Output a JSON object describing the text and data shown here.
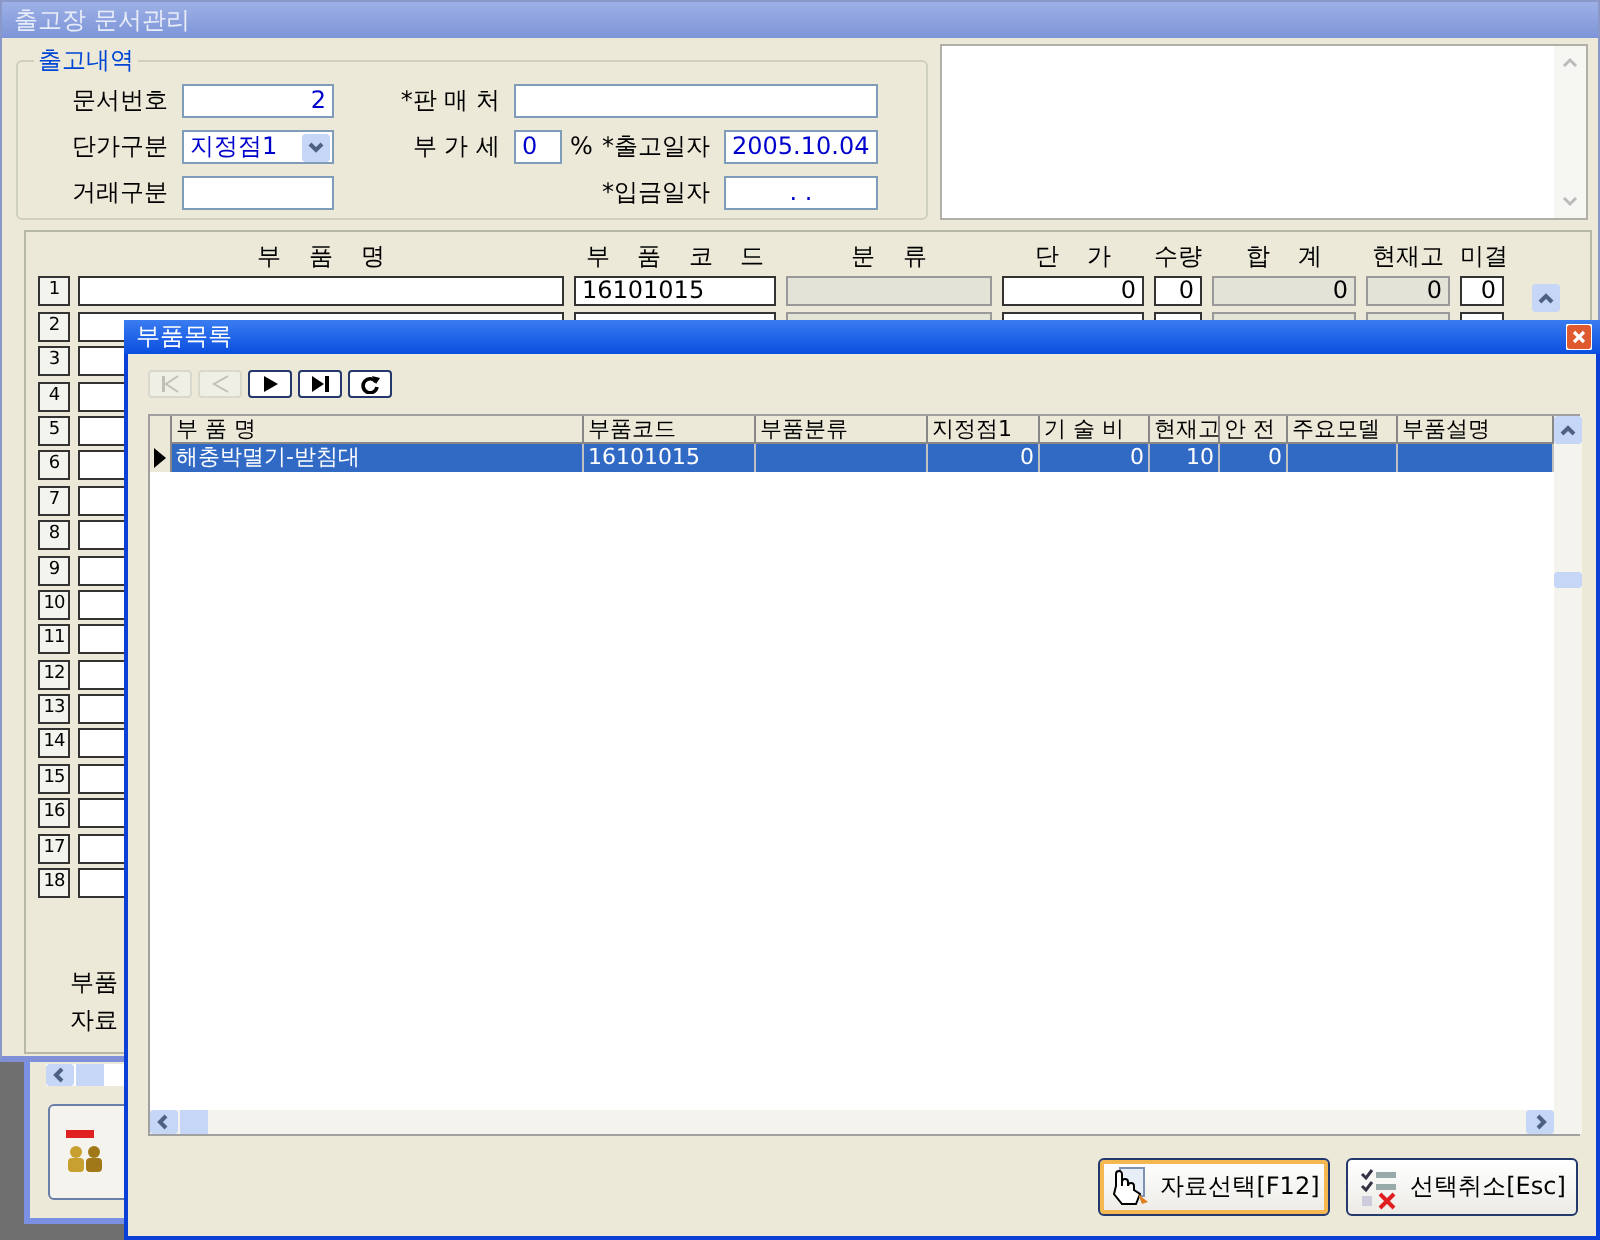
{
  "main_window": {
    "title": "출고장 문서관리",
    "details": {
      "title": "출고내역",
      "doc_no": {
        "label": "문서번호",
        "value": "2"
      },
      "seller": {
        "label": "*판 매 처"
      },
      "price_type": {
        "label": "단가구분",
        "value": "지정점1"
      },
      "vat": {
        "label": "부 가 세",
        "value": "0",
        "unit": "%"
      },
      "ship_date": {
        "label": "*출고일자",
        "value": "2005.10.04"
      },
      "trade_type": {
        "label": "거래구분"
      },
      "pay_date": {
        "label": "*입금일자",
        "value": ".   ."
      }
    },
    "items_grid": {
      "columns": [
        "부 품 명",
        "부 품 코 드",
        "분 류",
        "단 가",
        "수량",
        "합 계",
        "현재고",
        "미결"
      ],
      "rows": [
        {
          "number": "1",
          "code": "16101015",
          "price": "0",
          "qty": "0",
          "total": "0",
          "stock": "0",
          "pending": "0"
        },
        {
          "number": "2"
        },
        {
          "number": "3"
        },
        {
          "number": "4"
        },
        {
          "number": "5"
        },
        {
          "number": "6"
        },
        {
          "number": "7"
        },
        {
          "number": "8"
        },
        {
          "number": "9"
        },
        {
          "number": "10"
        },
        {
          "number": "11"
        },
        {
          "number": "12"
        },
        {
          "number": "13"
        },
        {
          "number": "14"
        },
        {
          "number": "15"
        },
        {
          "number": "16"
        },
        {
          "number": "17"
        },
        {
          "number": "18"
        }
      ]
    },
    "footer_labels": [
      "부품",
      "자료"
    ]
  },
  "part_dialog": {
    "title": "부품목록",
    "toolbar": [
      {
        "kind": "first",
        "disabled": true
      },
      {
        "kind": "prev",
        "disabled": true
      },
      {
        "kind": "next",
        "disabled": false
      },
      {
        "kind": "last",
        "disabled": false
      },
      {
        "kind": "refresh",
        "disabled": false
      }
    ],
    "grid": {
      "columns": [
        "부 품 명",
        "부품코드",
        "부품분류",
        "지정점1",
        "기 술 비",
        "현재고",
        "안   전",
        "주요모델",
        "부품설명"
      ],
      "rows": [
        {
          "selected": true,
          "name": "해충박멸기-받침대",
          "code": "16101015",
          "price": "0",
          "tech_fee": "0",
          "stock": "10",
          "safety": "0"
        }
      ]
    },
    "buttons": [
      {
        "kind": "select",
        "label": "자료선택[F12]",
        "focused": true
      },
      {
        "kind": "cancel",
        "label": "선택취소[Esc]",
        "focused": false
      }
    ]
  }
}
